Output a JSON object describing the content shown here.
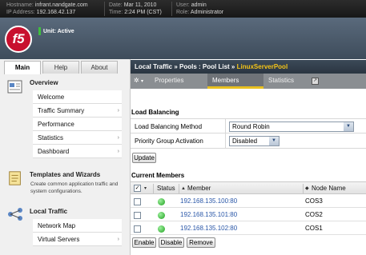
{
  "topbar": {
    "hostname_key": "Hostname:",
    "hostname": "infrant.nandgate.com",
    "ip_key": "IP Address:",
    "ip": "192.168.42.137",
    "date_key": "Date:",
    "date": "Mar 11, 2010",
    "time_key": "Time:",
    "time": "2:24 PM (CST)",
    "user_key": "User:",
    "user": "admin",
    "role_key": "Role:",
    "role": "Administrator"
  },
  "logo": "f5",
  "unit_status": "Unit: Active",
  "main_tabs": [
    "Main",
    "Help",
    "About"
  ],
  "sidebar": {
    "overview": {
      "title": "Overview",
      "items": [
        "Welcome",
        "Traffic Summary",
        "Performance",
        "Statistics",
        "Dashboard"
      ]
    },
    "templates": {
      "title": "Templates and Wizards",
      "description": "Create common application traffic and system configurations."
    },
    "local_traffic": {
      "title": "Local Traffic",
      "items": [
        "Network Map",
        "Virtual Servers"
      ]
    }
  },
  "breadcrumb": {
    "path": "Local Traffic  »  Pools : Pool List  »",
    "current": "LinuxServerPool"
  },
  "page_tabs": [
    "Properties",
    "Members",
    "Statistics"
  ],
  "load_balancing": {
    "heading": "Load Balancing",
    "method_label": "Load Balancing Method",
    "method_value": "Round Robin",
    "priority_label": "Priority Group Activation",
    "priority_value": "Disabled",
    "update_button": "Update"
  },
  "members": {
    "heading": "Current Members",
    "columns": [
      "Status",
      "Member",
      "Node Name"
    ],
    "rows": [
      {
        "member": "192.168.135.100:80",
        "node": "COS3"
      },
      {
        "member": "192.168.135.101:80",
        "node": "COS2"
      },
      {
        "member": "192.168.135.102:80",
        "node": "COS1"
      }
    ],
    "buttons": [
      "Enable",
      "Disable",
      "Remove"
    ]
  },
  "colors": {
    "accent": "#e8c020",
    "logo_red": "#c8102e",
    "status_green": "#1ea01e",
    "link": "#2a57a8"
  }
}
